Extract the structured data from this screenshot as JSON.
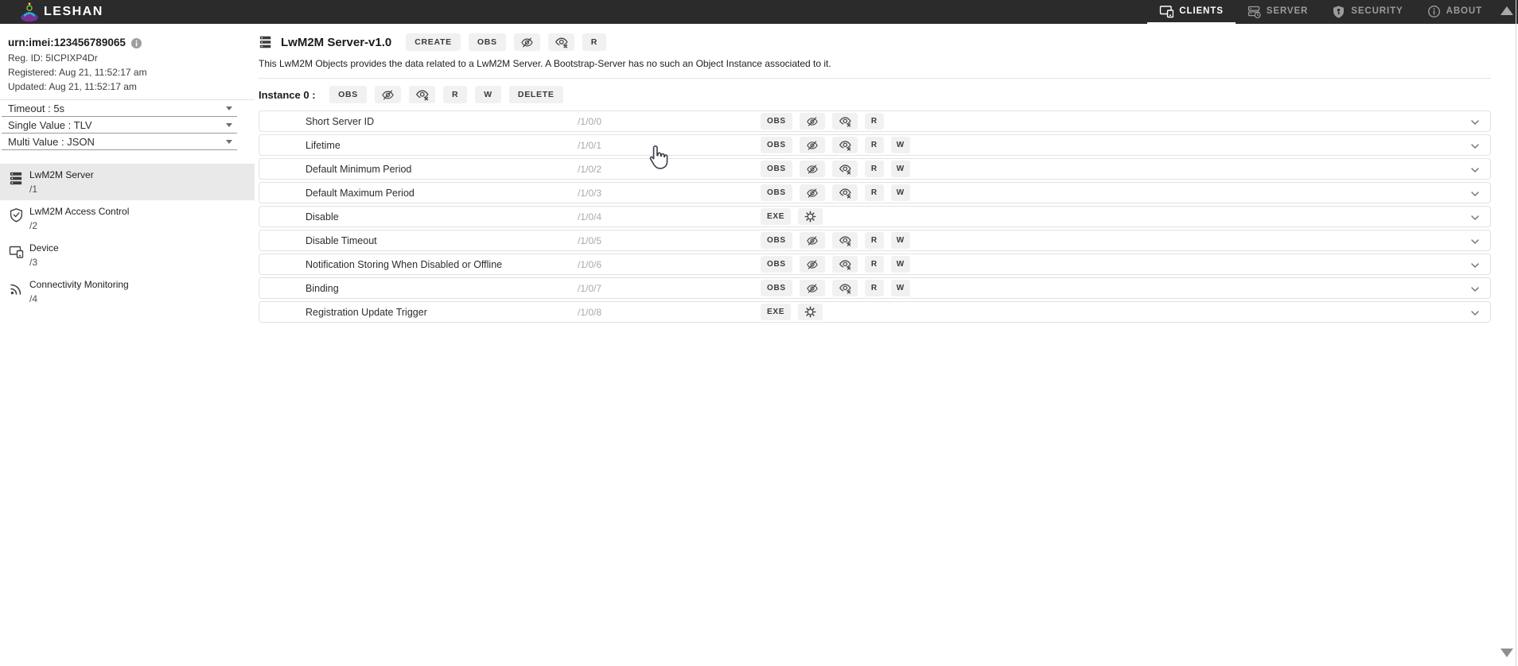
{
  "topbar": {
    "brand": "LESHAN",
    "nav": [
      {
        "label": "CLIENTS",
        "icon": "devices-icon",
        "active": true
      },
      {
        "label": "SERVER",
        "icon": "server-icon",
        "active": false
      },
      {
        "label": "SECURITY",
        "icon": "shield-key-icon",
        "active": false
      },
      {
        "label": "ABOUT",
        "icon": "info-icon",
        "active": false
      }
    ]
  },
  "sidebar": {
    "client": {
      "endpoint": "urn:imei:123456789065",
      "reg_id": {
        "label": "Reg. ID:",
        "value": "5ICPIXP4Dr"
      },
      "registered": {
        "label": "Registered:",
        "value": "Aug 21, 11:52:17 am"
      },
      "updated": {
        "label": "Updated:",
        "value": "Aug 21, 11:52:17 am"
      }
    },
    "settings": [
      {
        "label": "Timeout :",
        "value": "5s"
      },
      {
        "label": "Single Value :",
        "value": "TLV"
      },
      {
        "label": "Multi Value :",
        "value": "JSON"
      }
    ],
    "objects": [
      {
        "name": "LwM2M Server",
        "path": "/1",
        "icon": "dns-icon",
        "selected": true
      },
      {
        "name": "LwM2M Access Control",
        "path": "/2",
        "icon": "shield-check-icon",
        "selected": false
      },
      {
        "name": "Device",
        "path": "/3",
        "icon": "devices-icon",
        "selected": false
      },
      {
        "name": "Connectivity Monitoring",
        "path": "/4",
        "icon": "rss-icon",
        "selected": false
      }
    ]
  },
  "main": {
    "title": "LwM2M Server-v1.0",
    "description": "This LwM2M Objects provides the data related to a LwM2M Server. A Bootstrap-Server has no such an Object Instance associated to it.",
    "instance_label": "Instance 0 : ",
    "ops": {
      "create": "CREATE",
      "obs": "OBS",
      "read": "R",
      "write": "W",
      "exe": "EXE",
      "delete": "DELETE"
    },
    "resources": [
      {
        "name": "Short Server ID",
        "path": "/1/0/0",
        "access": "r"
      },
      {
        "name": "Lifetime",
        "path": "/1/0/1",
        "access": "rw"
      },
      {
        "name": "Default Minimum Period",
        "path": "/1/0/2",
        "access": "rw"
      },
      {
        "name": "Default Maximum Period",
        "path": "/1/0/3",
        "access": "rw"
      },
      {
        "name": "Disable",
        "path": "/1/0/4",
        "access": "e"
      },
      {
        "name": "Disable Timeout",
        "path": "/1/0/5",
        "access": "rw"
      },
      {
        "name": "Notification Storing When Disabled or Offline",
        "path": "/1/0/6",
        "access": "rw"
      },
      {
        "name": "Binding",
        "path": "/1/0/7",
        "access": "rw"
      },
      {
        "name": "Registration Update Trigger",
        "path": "/1/0/8",
        "access": "e"
      }
    ]
  },
  "colors": {
    "topbar_bg": "#2b2b2b",
    "nav_active": "#ffffff",
    "nav_inactive": "#9b9b9b",
    "button_bg": "#f1f1f1",
    "selected_item_bg": "#e9e9e9",
    "path_text": "#a9a9a9",
    "divider": "#e2e2e2"
  }
}
